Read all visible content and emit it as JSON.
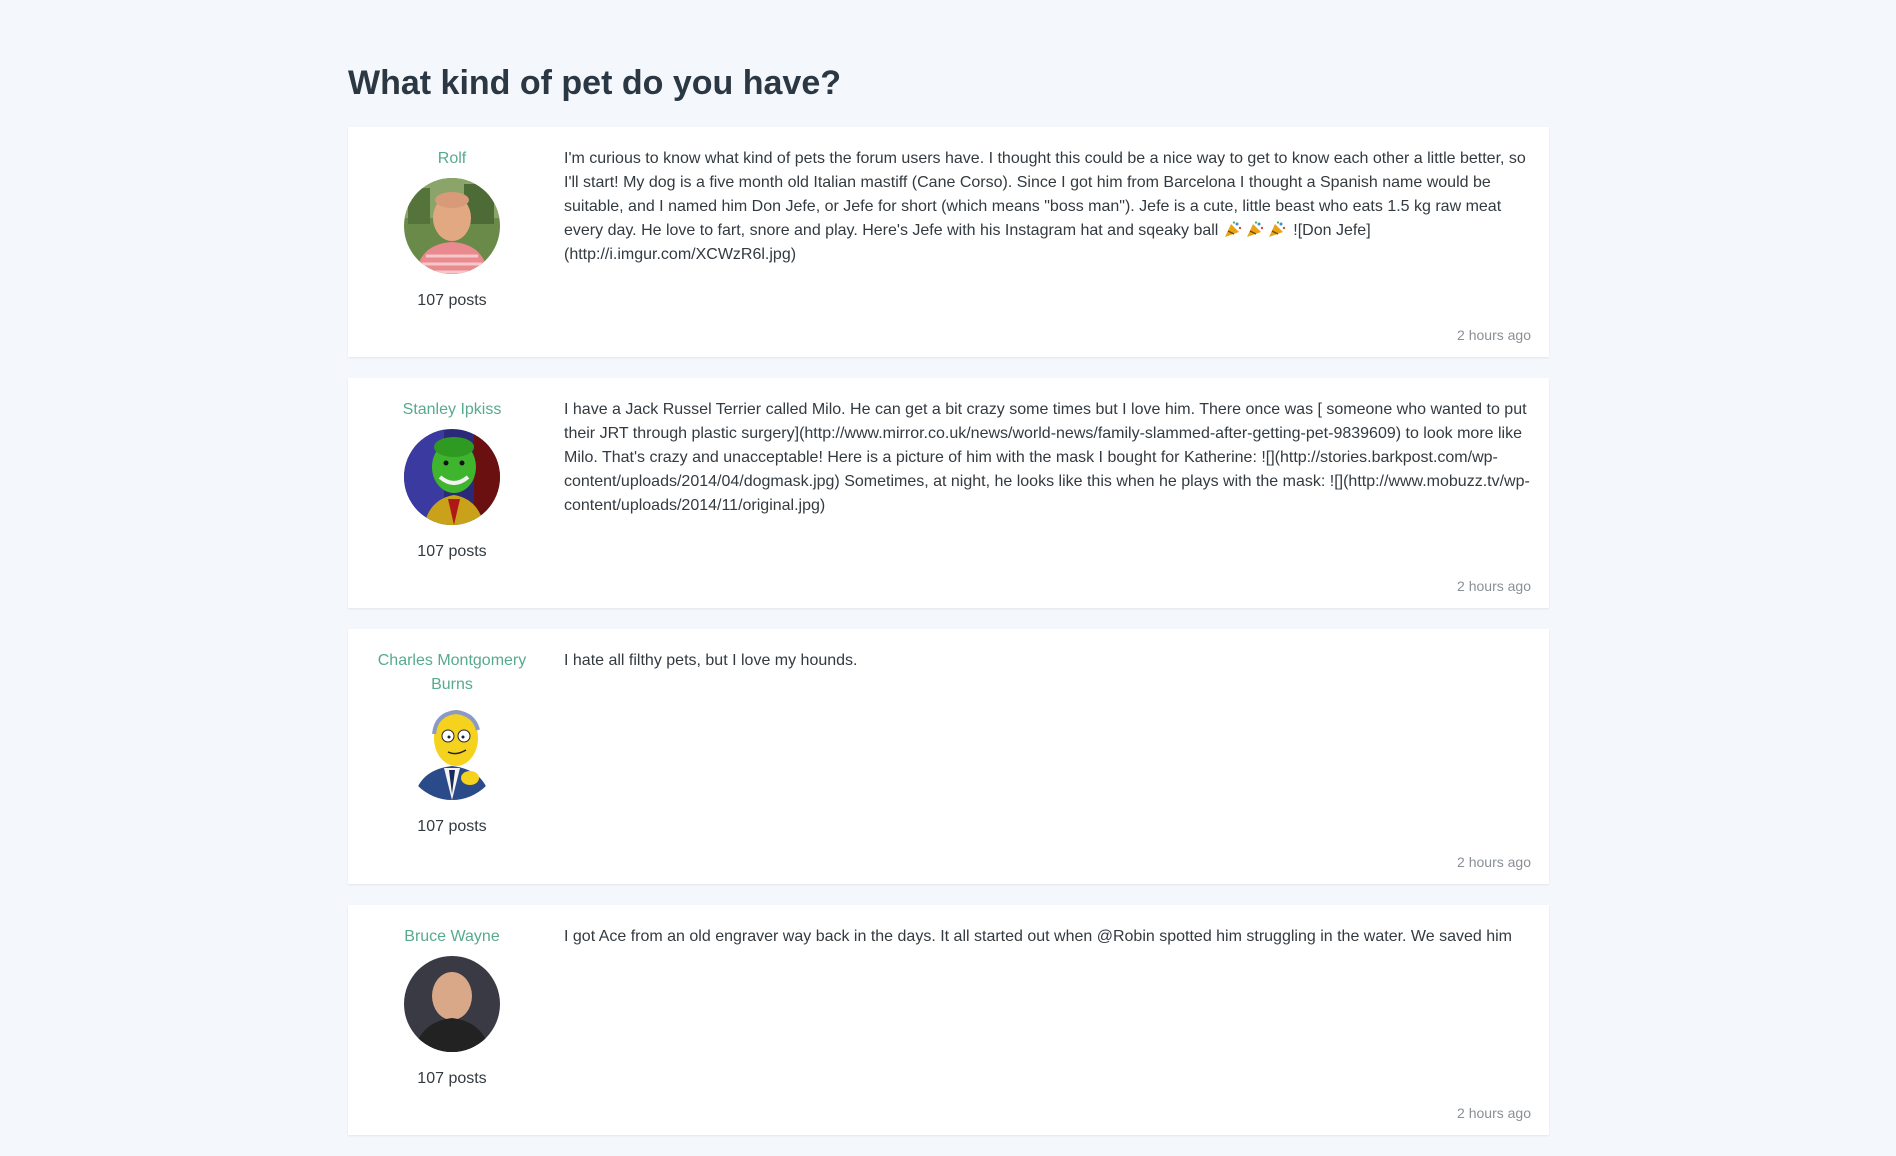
{
  "thread": {
    "title": "What kind of pet do you have?"
  },
  "posts": [
    {
      "author": "Rolf",
      "post_count": "107 posts",
      "content_before": "I'm curious to know what kind of pets the forum users have. I thought this could be a nice way to get to know each other a little better, so I'll start! My dog is a five month old Italian mastiff (Cane Corso). Since I got him from Barcelona I thought a Spanish name would be suitable, and I named him Don Jefe, or Jefe for short (which means \"boss man\"). Jefe is a cute, little beast who eats 1.5 kg raw meat every day. He love to fart, snore and play. Here's Jefe with his Instagram hat and sqeaky ball",
      "emoji_icons": [
        "party-popper-icon",
        "party-popper-icon",
        "party-popper-icon"
      ],
      "content_after": "![Don Jefe](http://i.imgur.com/XCWzR6l.jpg)",
      "time": "2 hours ago"
    },
    {
      "author": "Stanley Ipkiss",
      "post_count": "107 posts",
      "content": "I have a Jack Russel Terrier called Milo. He can get a bit crazy some times but I love him. There once was [ someone who wanted to put their JRT through plastic surgery](http://www.mirror.co.uk/news/world-news/family-slammed-after-getting-pet-9839609) to look more like Milo. That's crazy and unacceptable! Here is a picture of him with the mask I bought for Katherine: ![](http://stories.barkpost.com/wp-content/uploads/2014/04/dogmask.jpg) Sometimes, at night, he looks like this when he plays with the mask: ![](http://www.mobuzz.tv/wp-content/uploads/2014/11/original.jpg)",
      "time": "2 hours ago"
    },
    {
      "author": "Charles Montgomery Burns",
      "post_count": "107 posts",
      "content": "I hate all filthy pets, but I love my hounds.",
      "time": "2 hours ago"
    },
    {
      "author": "Bruce Wayne",
      "post_count": "107 posts",
      "content": "I got Ace from an old engraver way back in the days. It all started out when @Robin spotted him struggling in the water. We saved him",
      "time": "2 hours ago"
    }
  ],
  "colors": {
    "background": "#f4f8fd",
    "card": "#ffffff",
    "author_link": "#57aa8d",
    "text": "#333a40",
    "muted": "#8a9096",
    "title": "#2b3742"
  }
}
